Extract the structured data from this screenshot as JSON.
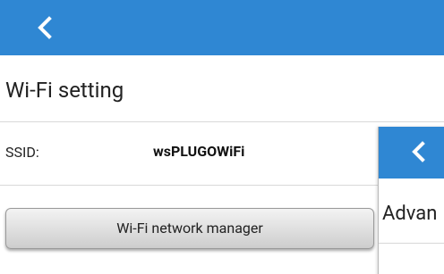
{
  "header": {
    "back_icon": "chevron-left-icon",
    "color": "#2f87d3"
  },
  "page": {
    "title": "Wi-Fi setting"
  },
  "ssid": {
    "label": "SSID:",
    "value": "wsPLUGOWiFi"
  },
  "actions": {
    "wifi_manager_label": "Wi-Fi network manager"
  },
  "overlay_panel": {
    "back_icon": "chevron-left-icon",
    "title": "Advan"
  }
}
